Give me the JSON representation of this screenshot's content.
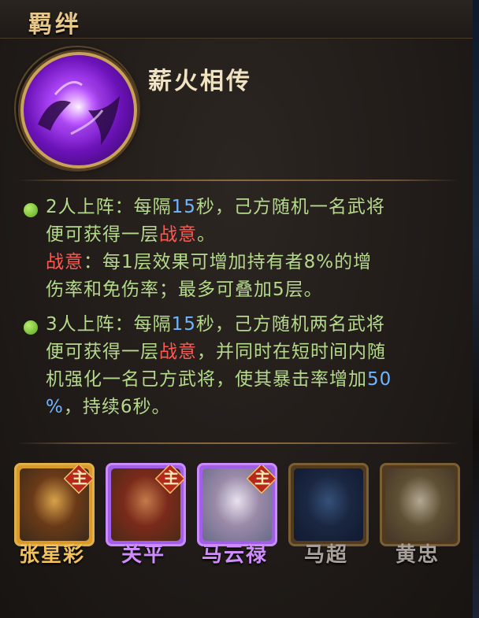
{
  "header": {
    "title": "羁绊"
  },
  "bond": {
    "name": "薪火相传",
    "emblem_icon": "flame-hands-icon"
  },
  "effects": [
    {
      "lines": [
        [
          {
            "t": "2人上阵：每隔"
          },
          {
            "t": "15",
            "c": "num"
          },
          {
            "t": "秒，己方随机一名武将"
          }
        ],
        [
          {
            "t": "便可获得一层"
          },
          {
            "t": "战意",
            "c": "kw"
          },
          {
            "t": "。"
          }
        ],
        [
          {
            "t": "战意",
            "c": "kw"
          },
          {
            "t": "：每1层效果可增加持有者8%的增"
          }
        ],
        [
          {
            "t": "伤率和免伤率；最多可叠加5层。"
          }
        ]
      ]
    },
    {
      "lines": [
        [
          {
            "t": "3人上阵：每隔"
          },
          {
            "t": "15",
            "c": "num"
          },
          {
            "t": "秒，己方随机两名武将"
          }
        ],
        [
          {
            "t": "便可获得一层"
          },
          {
            "t": "战意",
            "c": "kw"
          },
          {
            "t": "，并同时在短时间内随"
          }
        ],
        [
          {
            "t": "机强化一名己方武将，使其暴击率增加"
          },
          {
            "t": "50",
            "c": "num"
          }
        ],
        [
          {
            "t": "%",
            "c": "num"
          },
          {
            "t": "，持续6秒。"
          }
        ]
      ]
    }
  ],
  "heroes": [
    {
      "name": "张星彩",
      "frame": "gold",
      "badge": "主",
      "colors": [
        "#3a2a1a",
        "#d8a24a",
        "#6a3a18"
      ]
    },
    {
      "name": "关平",
      "frame": "purple",
      "badge": "主",
      "colors": [
        "#4a2a18",
        "#c47a4a",
        "#7a2a1a"
      ]
    },
    {
      "name": "马云禄",
      "frame": "purple",
      "badge": "主",
      "colors": [
        "#6a6a8a",
        "#e8e2ef",
        "#9a8aa8"
      ]
    },
    {
      "name": "马超",
      "frame": "dim",
      "badge": "",
      "colors": [
        "#0e1a34",
        "#3a5a8a",
        "#1a2a4a"
      ]
    },
    {
      "name": "黄忠",
      "frame": "dim",
      "badge": "",
      "colors": [
        "#4a3a2a",
        "#cfc1a8",
        "#6a5a3a"
      ]
    }
  ],
  "colors": {
    "effect_text": "#b5d98c",
    "keyword": "#ff5a52",
    "number": "#6fb6ff",
    "title": "#e8c98a"
  }
}
